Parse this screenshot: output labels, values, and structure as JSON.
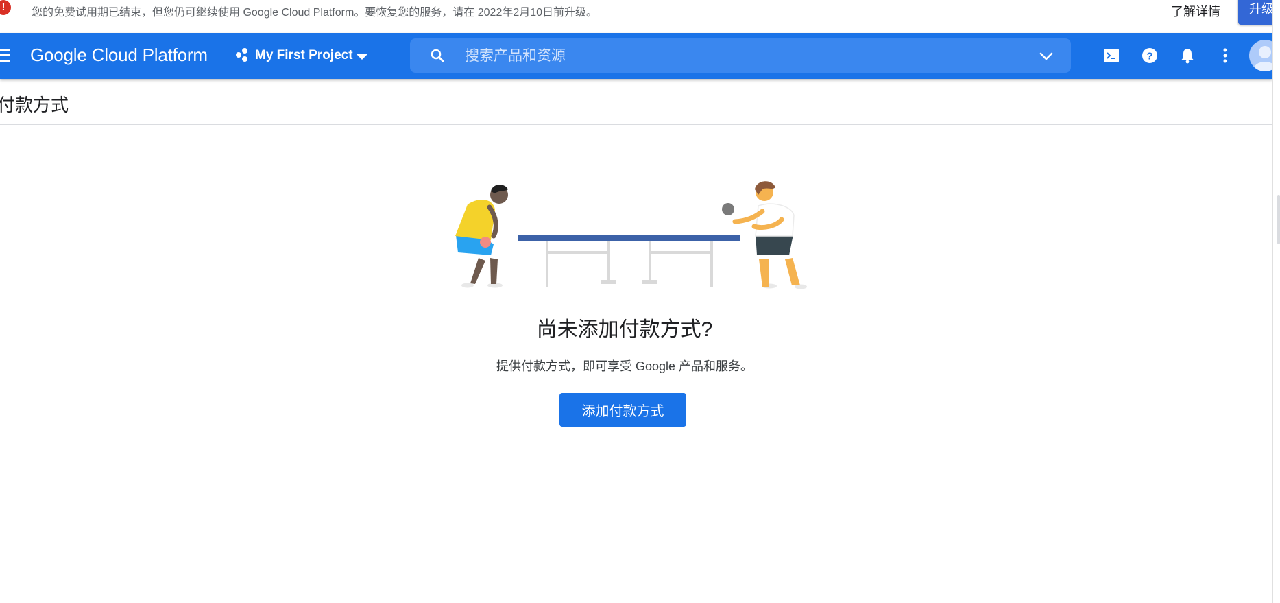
{
  "banner": {
    "alert_glyph": "!",
    "message": "您的免费试用期已结束，但您仍可继续使用 Google Cloud Platform。要恢复您的服务，请在 2022年2月10日前升级。",
    "learn_more": "了解详情",
    "upgrade": "升级"
  },
  "header": {
    "title": "Google Cloud Platform",
    "project": "My First Project",
    "search_placeholder": "搜索产品和资源",
    "icons": [
      "menu-icon",
      "project-dots-icon",
      "search-icon",
      "chevron-down-icon",
      "cloud-shell-icon",
      "help-icon",
      "notifications-icon",
      "more-vert-icon",
      "avatar"
    ]
  },
  "page": {
    "title": "付款方式"
  },
  "empty_state": {
    "heading": "尚未添加付款方式?",
    "subtext": "提供付款方式，即可享受 Google 产品和服务。",
    "button": "添加付款方式"
  },
  "colors": {
    "brand_blue": "#1a73e8",
    "search_blue": "#3a87ef",
    "alert_red": "#d93025",
    "upgrade_blue": "#3367d6"
  }
}
